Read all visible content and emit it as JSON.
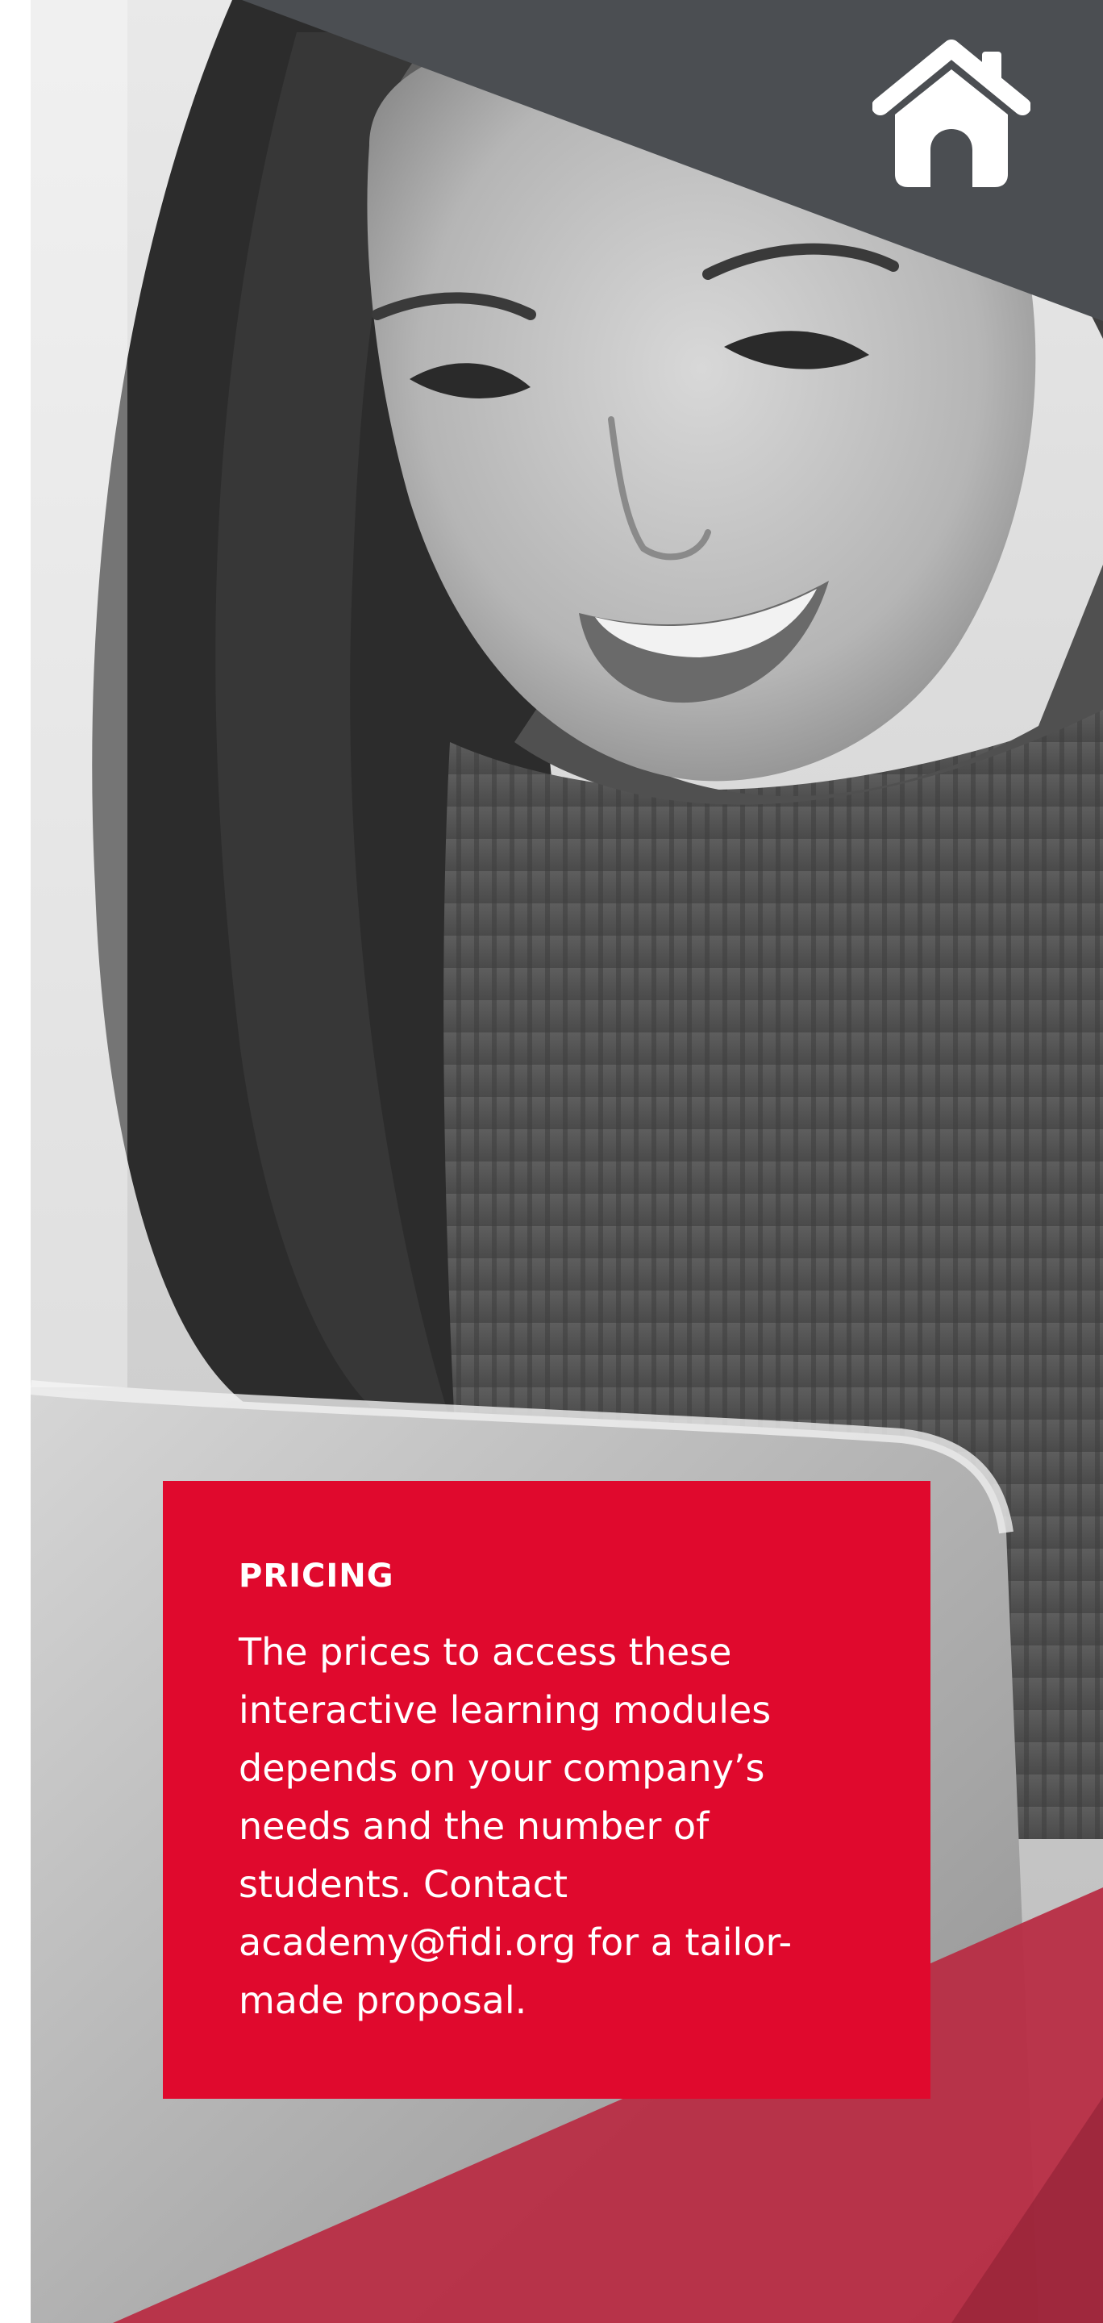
{
  "nav": {
    "home_icon": "home-icon"
  },
  "colors": {
    "accent_red": "#e0092d",
    "band_red": "#b82d44",
    "banner_gray": "#4b4e52"
  },
  "pricing": {
    "title": "PRICING",
    "body_before_email": "The prices to access these interactive learning modules depends on your company’s needs and the number of students. Contact ",
    "email": "academy@fidi.org",
    "body_after_email": " for a tailor-made proposal."
  }
}
